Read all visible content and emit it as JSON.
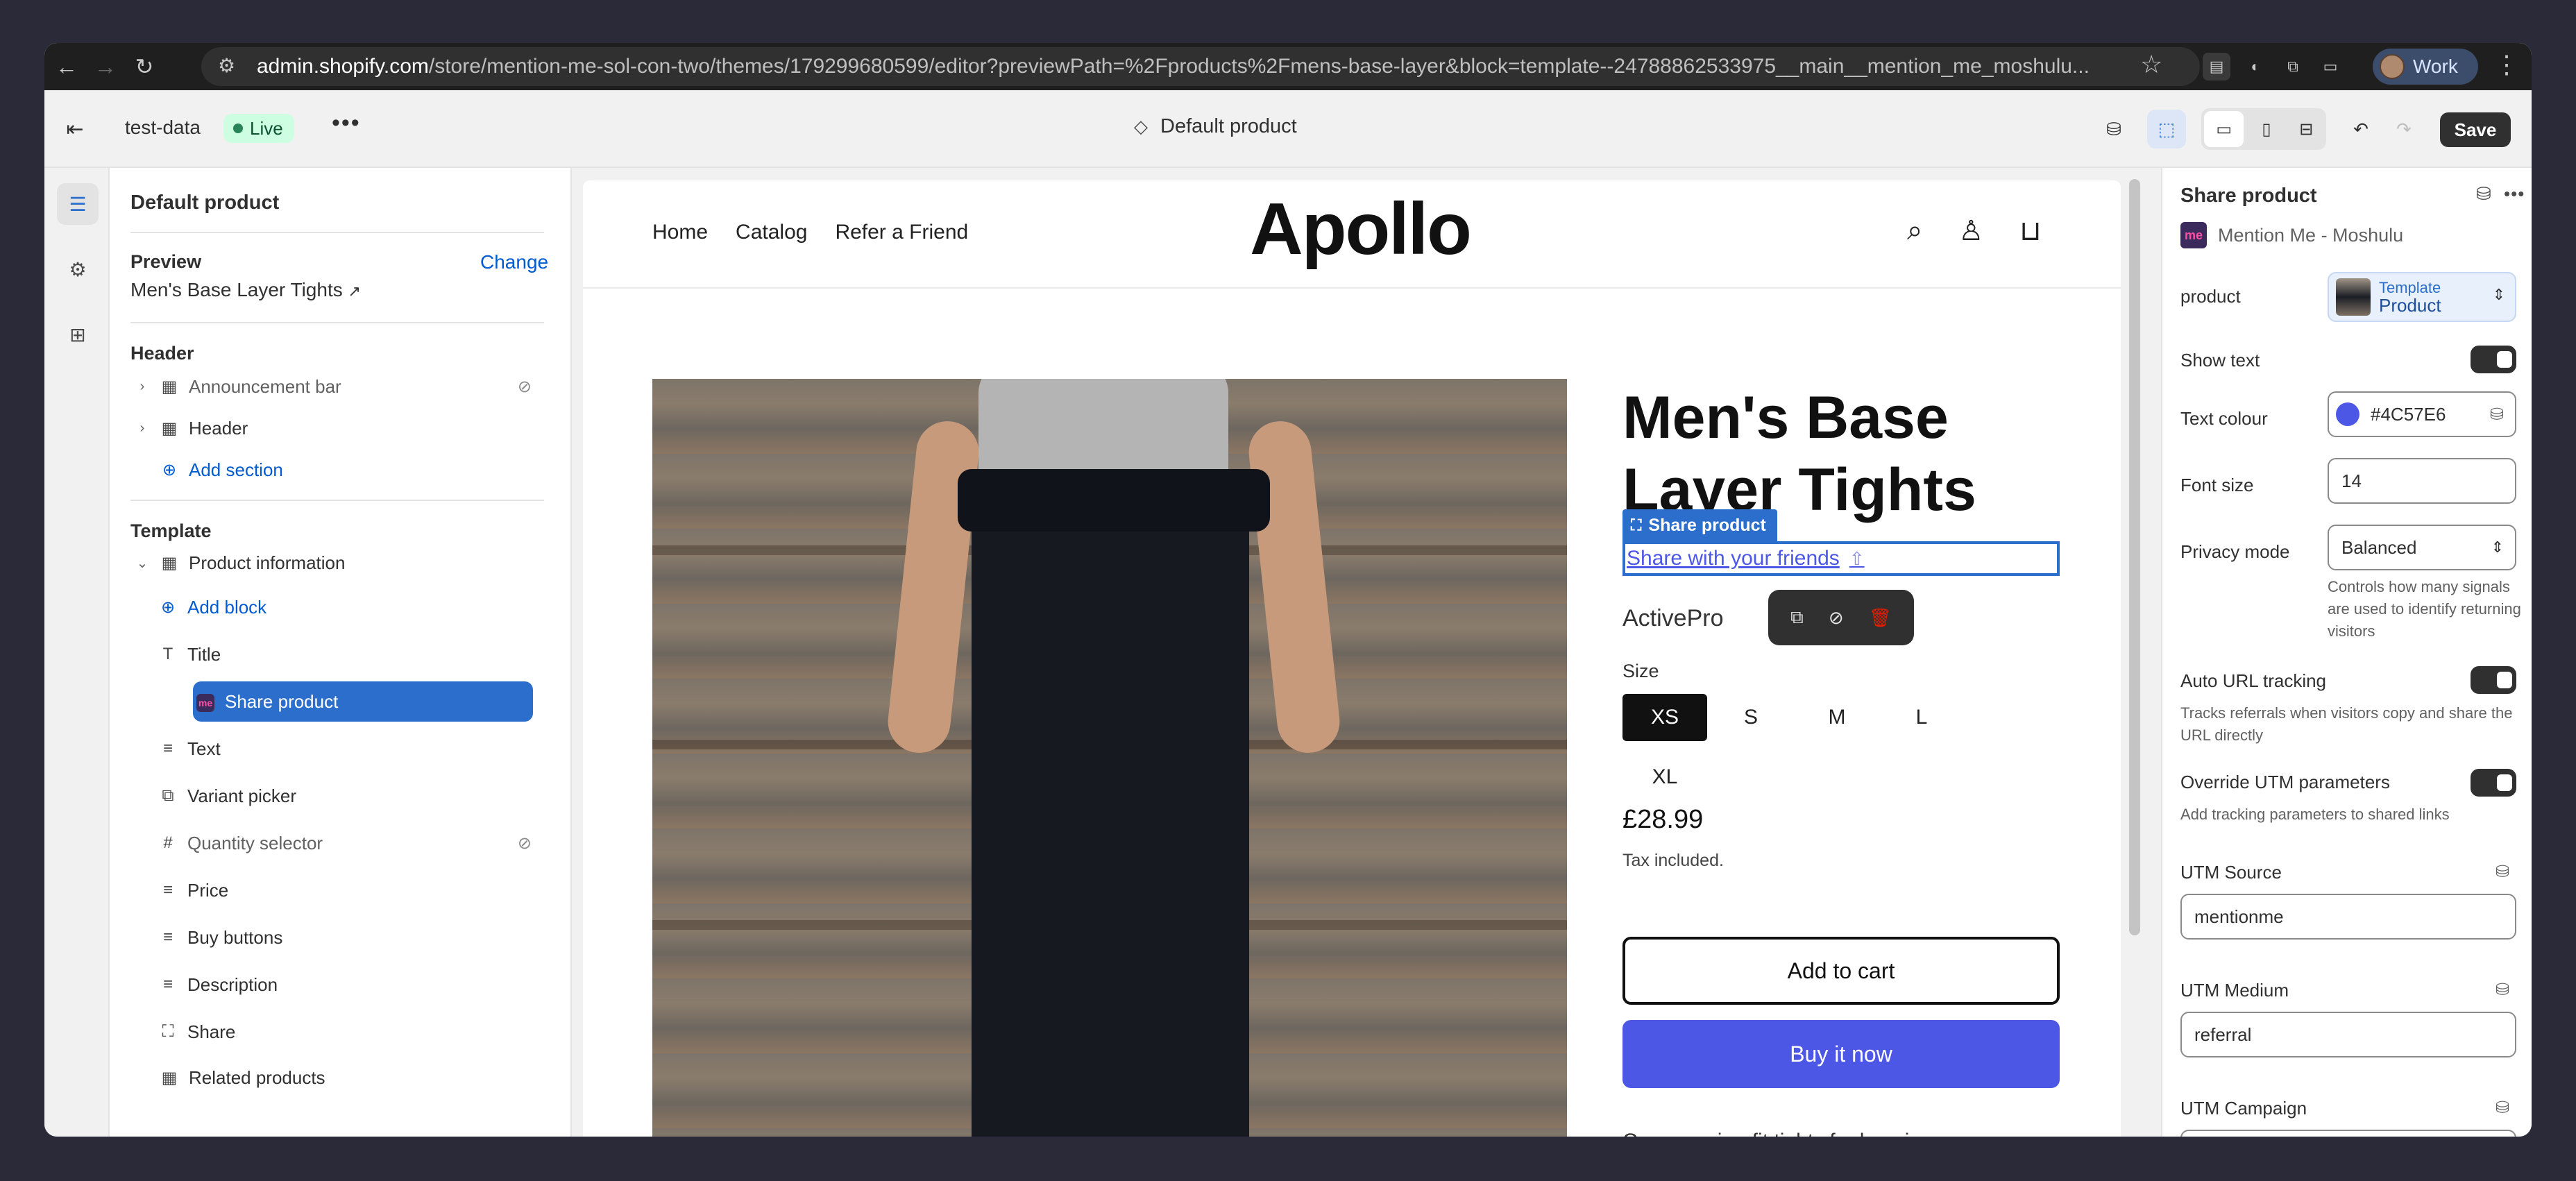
{
  "browser": {
    "url_domain": "admin.shopify.com",
    "url_rest": "/store/mention-me-sol-con-two/themes/179299680599/editor?previewPath=%2Fproducts%2Fmens-base-layer&block=template--24788862533975__main__mention_me_moshulu...",
    "profile_label": "Work"
  },
  "topbar": {
    "store_name": "test-data",
    "status": "Live",
    "template_name": "Default product",
    "save_label": "Save"
  },
  "left_panel": {
    "title": "Default product",
    "preview_heading": "Preview",
    "change_link": "Change",
    "preview_product": "Men's Base Layer Tights",
    "header_heading": "Header",
    "header_items": [
      {
        "label": "Announcement bar",
        "hidden": true
      },
      {
        "label": "Header",
        "hidden": false
      }
    ],
    "add_section": "Add section",
    "template_heading": "Template",
    "section_name": "Product information",
    "add_block": "Add block",
    "blocks": [
      {
        "label": "Title",
        "icon": "text-title-icon"
      },
      {
        "label": "Share product",
        "icon": "mention-me-app-icon",
        "selected": true
      },
      {
        "label": "Text",
        "icon": "text-lines-icon"
      },
      {
        "label": "Variant picker",
        "icon": "variant-icon"
      },
      {
        "label": "Quantity selector",
        "icon": "hash-icon",
        "hidden": true
      },
      {
        "label": "Price",
        "icon": "text-lines-icon"
      },
      {
        "label": "Buy buttons",
        "icon": "text-lines-icon"
      },
      {
        "label": "Description",
        "icon": "text-lines-icon"
      },
      {
        "label": "Share",
        "icon": "share-frame-icon"
      }
    ],
    "related": "Related products"
  },
  "preview": {
    "nav_links": [
      "Home",
      "Catalog",
      "Refer a Friend"
    ],
    "logo": "Apollo",
    "product_title": "Men's Base Layer Tights",
    "block_badge": "Share product",
    "share_link": "Share with your friends",
    "vendor": "ActivePro",
    "size_label": "Size",
    "sizes": [
      "XS",
      "S",
      "M",
      "L",
      "XL"
    ],
    "selected_size": "XS",
    "price": "£28.99",
    "tax_note": "Tax included.",
    "add_to_cart": "Add to cart",
    "buy_now": "Buy it now",
    "description_start": "Compression-fit tights for layering"
  },
  "right_panel": {
    "title": "Share product",
    "app_name": "Mention Me - Moshulu",
    "product_label": "product",
    "product_pick_kind": "Template",
    "product_pick_value": "Product",
    "show_text_label": "Show text",
    "show_text": true,
    "text_colour_label": "Text colour",
    "text_colour": "#4C57E6",
    "font_size_label": "Font size",
    "font_size": "14",
    "privacy_label": "Privacy mode",
    "privacy_value": "Balanced",
    "privacy_help": "Controls how many signals are used to identify returning visitors",
    "auto_url_label": "Auto URL tracking",
    "auto_url": true,
    "auto_url_help": "Tracks referrals when visitors copy and share the URL directly",
    "override_utm_label": "Override UTM parameters",
    "override_utm": true,
    "override_utm_help": "Add tracking parameters to shared links",
    "utm_source_label": "UTM Source",
    "utm_source": "mentionme",
    "utm_medium_label": "UTM Medium",
    "utm_medium": "referral",
    "utm_campaign_label": "UTM Campaign"
  }
}
